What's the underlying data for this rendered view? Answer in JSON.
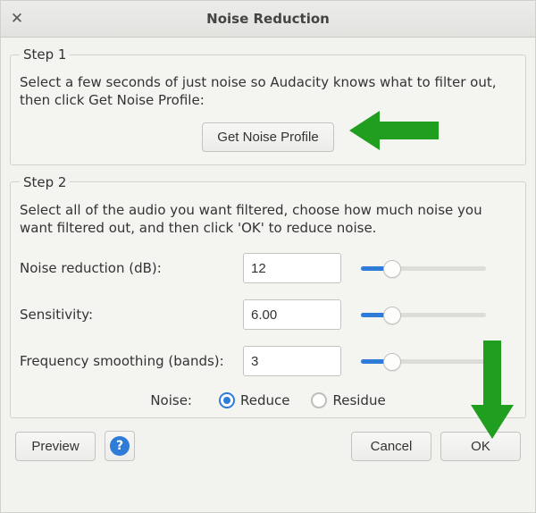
{
  "titlebar": {
    "title": "Noise Reduction",
    "close_glyph": "✕"
  },
  "step1": {
    "legend": "Step 1",
    "instruction": "Select a few seconds of just noise so Audacity knows what to filter out, then click Get Noise Profile:",
    "button": "Get Noise Profile"
  },
  "step2": {
    "legend": "Step 2",
    "instruction": "Select all of the audio you want filtered, choose how much noise you want filtered out, and then click 'OK' to reduce noise.",
    "params": {
      "noise_reduction": {
        "label": "Noise reduction (dB):",
        "value": "12",
        "slider_pct": 25
      },
      "sensitivity": {
        "label": "Sensitivity:",
        "value": "6.00",
        "slider_pct": 25
      },
      "freq_smoothing": {
        "label": "Frequency smoothing (bands):",
        "value": "3",
        "slider_pct": 25
      }
    },
    "radio": {
      "label": "Noise:",
      "option1": "Reduce",
      "option2": "Residue",
      "selected": "Reduce"
    }
  },
  "buttons": {
    "preview": "Preview",
    "help": "?",
    "cancel": "Cancel",
    "ok": "OK"
  },
  "colors": {
    "accent": "#2f7bd8",
    "arrow": "#1f9e1f"
  }
}
